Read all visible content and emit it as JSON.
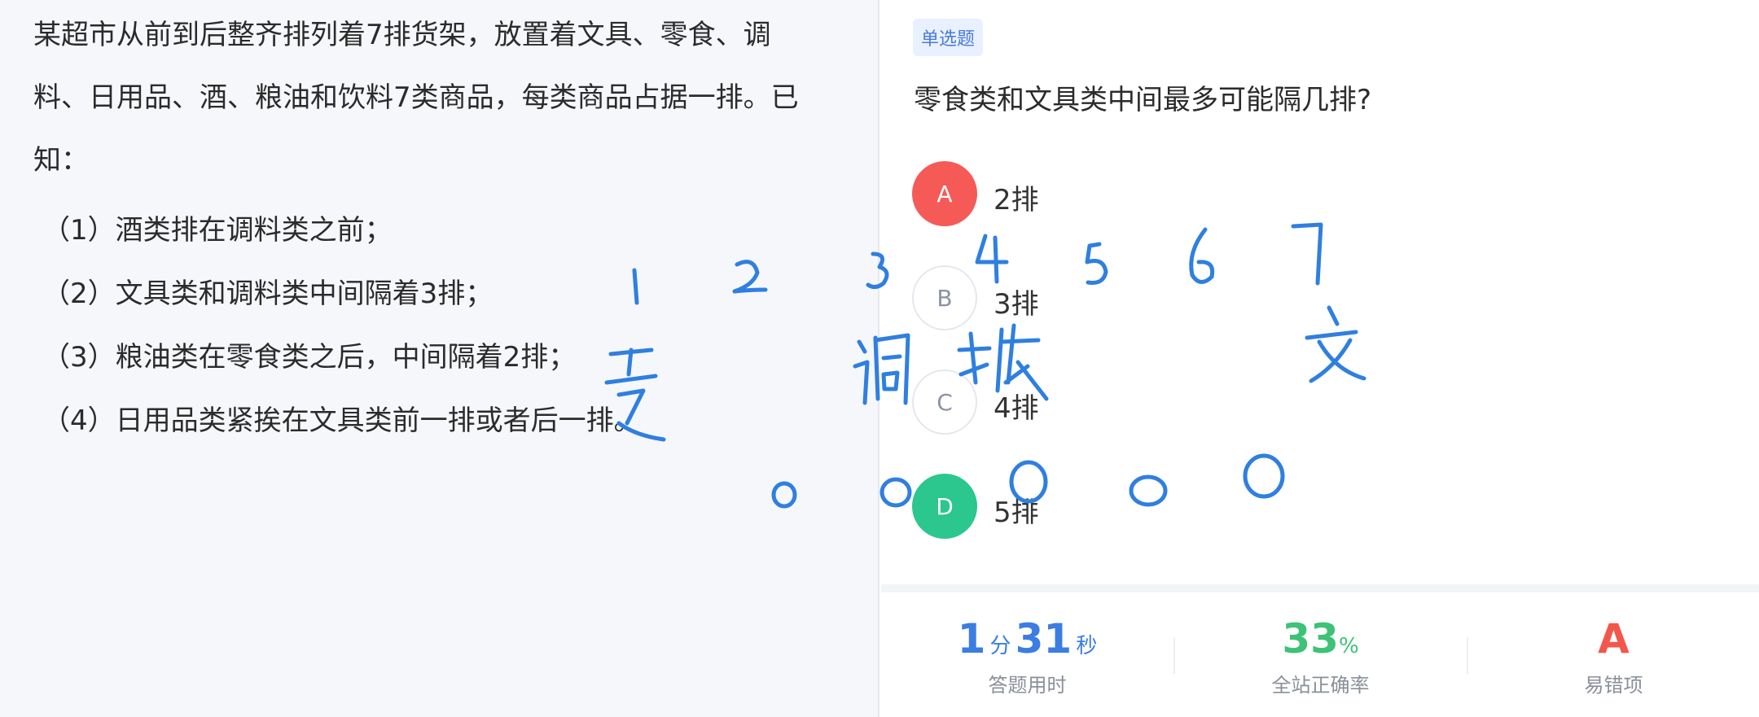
{
  "stem": {
    "line1": "某超市从前到后整齐排列着7排货架，放置着文具、零食、调",
    "line2": "料、日用品、酒、粮油和饮料7类商品，每类商品占据一排。已",
    "line3": "知："
  },
  "conditions": [
    "（1）酒类排在调料类之前；",
    "（2）文具类和调料类中间隔着3排；",
    "（3）粮油类在零食类之后，中间隔着2排；",
    "（4）日用品类紧挨在文具类前一排或者后一排。"
  ],
  "question": {
    "type_tag": "单选题",
    "text": "零食类和文具类中间最多可能隔几排?"
  },
  "options": [
    {
      "letter": "A",
      "text": "2排",
      "state": "wrong"
    },
    {
      "letter": "B",
      "text": "3排",
      "state": "plain"
    },
    {
      "letter": "C",
      "text": "4排",
      "state": "plain"
    },
    {
      "letter": "D",
      "text": "5排",
      "state": "correct"
    }
  ],
  "stats": {
    "time": {
      "minutes": "1",
      "minutes_unit": "分",
      "seconds": "31",
      "seconds_unit": "秒",
      "label": "答题用时"
    },
    "accuracy": {
      "value": "33",
      "unit": "%",
      "label": "全站正确率"
    },
    "common_wrong": {
      "value": "A",
      "label": "易错项"
    }
  },
  "handwriting": {
    "numbers": [
      "1",
      "2",
      "3",
      "4",
      "5",
      "6",
      "7"
    ],
    "words": [
      "零",
      "调",
      "粮",
      "文"
    ]
  },
  "colors": {
    "wrong": "#f65a57",
    "correct": "#2cc68f",
    "accent_blue": "#3b7de3",
    "accent_green": "#3dc277",
    "accent_red": "#f2574b",
    "ink": "#2f7fe0"
  }
}
